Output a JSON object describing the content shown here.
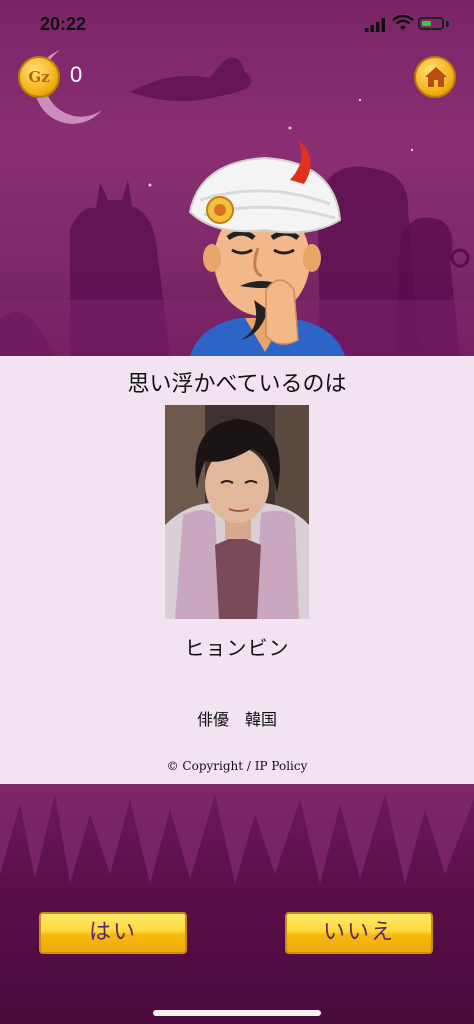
{
  "status_bar": {
    "time": "20:22"
  },
  "header": {
    "coin_label": "Gz",
    "score": "0"
  },
  "result": {
    "question": "思い浮かべているのは",
    "name": "ヒョンビン",
    "description": "俳優　韓国",
    "copyright": "© Copyright / IP Policy"
  },
  "answers": {
    "yes_label": "はい",
    "no_label": "いいえ"
  },
  "icons": [
    "coin-icon",
    "home-icon",
    "signal-icon",
    "wifi-icon",
    "battery-icon"
  ],
  "colors": {
    "accent_gold": "#f6b90e",
    "background_purple": "#7a2466",
    "panel": "#f1e3ef",
    "button_text": "#5a2a6a"
  }
}
